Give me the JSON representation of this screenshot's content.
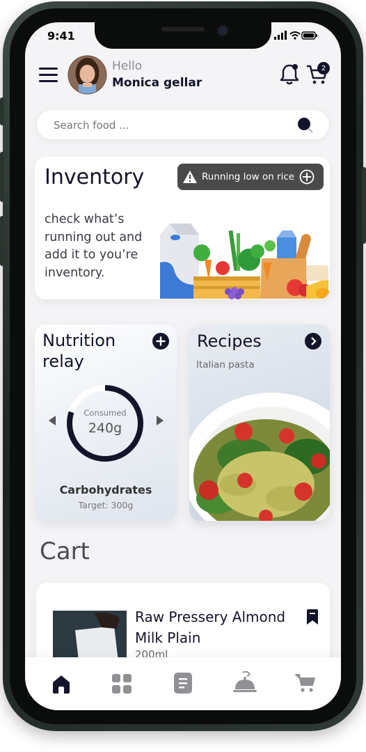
{
  "status_bar": {
    "time": "9:41"
  },
  "header": {
    "greeting": "Hello",
    "user_name": "Monica gellar",
    "cart_badge": "2"
  },
  "search": {
    "placeholder": "Search food ..."
  },
  "inventory": {
    "title": "Inventory",
    "alert_text": "Running low on rice",
    "description": "check what’s running out and add it to you’re inventory."
  },
  "nutrition": {
    "title": "Nutrition relay",
    "consumed_label": "Consumed",
    "consumed_value": "240g",
    "nutrient": "Carbohydrates",
    "target": "Target: 300g",
    "progress_fraction": 0.8
  },
  "recipes": {
    "title": "Recipes",
    "subtitle": "Italian pasta"
  },
  "cart": {
    "title": "Cart",
    "item": {
      "name": "Raw Pressery Almond Milk Plain",
      "size": "200ml"
    }
  },
  "colors": {
    "primary_dark": "#14142b",
    "alert_bg": "#4a4a4a",
    "background": "#f4f4f6"
  },
  "icons": [
    "menu-icon",
    "bell-icon",
    "cart-icon",
    "search-icon",
    "warning-icon",
    "plus-circle-icon",
    "chevron-right-icon",
    "bookmark-icon",
    "home-icon",
    "grid-icon",
    "list-icon",
    "cloche-icon"
  ]
}
